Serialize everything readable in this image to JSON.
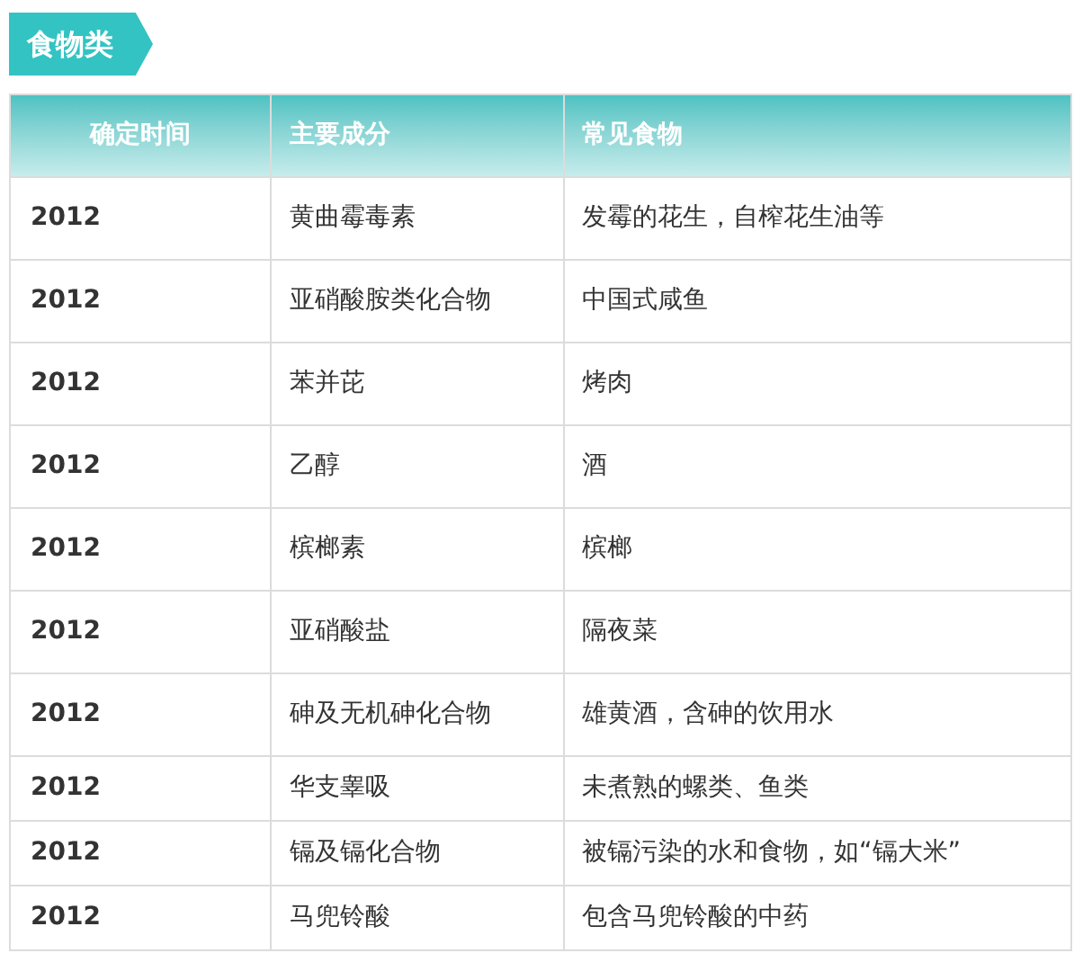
{
  "tag": {
    "label": "食物类"
  },
  "table": {
    "columns": [
      "确定时间",
      "主要成分",
      "常见食物"
    ],
    "rows": [
      [
        "2012",
        "黄曲霉毒素",
        "发霉的花生，自榨花生油等"
      ],
      [
        "2012",
        "亚硝酸胺类化合物",
        "中国式咸鱼"
      ],
      [
        "2012",
        "苯并芘",
        "烤肉"
      ],
      [
        "2012",
        "乙醇",
        "酒"
      ],
      [
        "2012",
        "槟榔素",
        "槟榔"
      ],
      [
        "2012",
        "亚硝酸盐",
        "隔夜菜"
      ],
      [
        "2012",
        "砷及无机砷化合物",
        "雄黄酒，含砷的饮用水"
      ],
      [
        "2012",
        "华支睾吸",
        "未煮熟的螺类、鱼类"
      ],
      [
        "2012",
        "镉及镉化合物",
        "被镉污染的水和食物，如“镉大米”"
      ],
      [
        "2012",
        "马兜铃酸",
        "包含马兜铃酸的中药"
      ]
    ]
  }
}
